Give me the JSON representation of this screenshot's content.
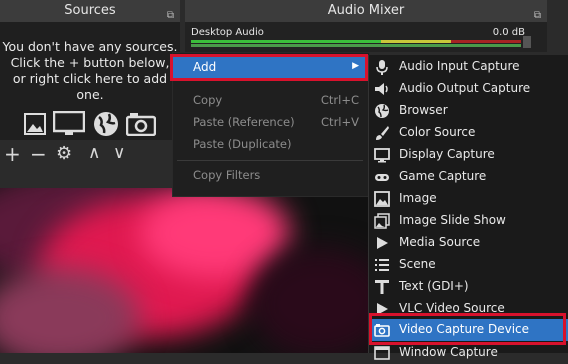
{
  "sources_dock": {
    "title": "Sources",
    "empty_message_line1": "You don't have any sources.",
    "empty_message_line2": "Click the + button below,",
    "empty_message_line3": "or right click here to add one.",
    "toolbar": {
      "add": "+",
      "remove": "−",
      "settings": "⚙",
      "up": "∧",
      "down": "∨"
    }
  },
  "audio_mixer": {
    "title": "Audio Mixer",
    "channel_name": "Desktop Audio",
    "channel_level": "0.0 dB"
  },
  "context_menu": {
    "add": "Add",
    "copy": "Copy",
    "copy_shortcut": "Ctrl+C",
    "paste_reference": "Paste (Reference)",
    "paste_reference_shortcut": "Ctrl+V",
    "paste_duplicate": "Paste (Duplicate)",
    "copy_filters": "Copy Filters"
  },
  "add_submenu": {
    "items": [
      {
        "label": "Audio Input Capture",
        "icon": "microphone-icon"
      },
      {
        "label": "Audio Output Capture",
        "icon": "speaker-icon"
      },
      {
        "label": "Browser",
        "icon": "globe-icon"
      },
      {
        "label": "Color Source",
        "icon": "paint-brush-icon"
      },
      {
        "label": "Display Capture",
        "icon": "monitor-icon"
      },
      {
        "label": "Game Capture",
        "icon": "gamepad-icon"
      },
      {
        "label": "Image",
        "icon": "image-icon"
      },
      {
        "label": "Image Slide Show",
        "icon": "slideshow-icon"
      },
      {
        "label": "Media Source",
        "icon": "play-icon"
      },
      {
        "label": "Scene",
        "icon": "list-icon"
      },
      {
        "label": "Text (GDI+)",
        "icon": "text-icon"
      },
      {
        "label": "VLC Video Source",
        "icon": "play-icon"
      },
      {
        "label": "Video Capture Device",
        "icon": "camera-icon"
      },
      {
        "label": "Window Capture",
        "icon": "window-icon"
      }
    ],
    "selected": "Video Capture Device"
  },
  "colors": {
    "accent": "#2f74c4",
    "highlight_box": "#d8122d"
  }
}
